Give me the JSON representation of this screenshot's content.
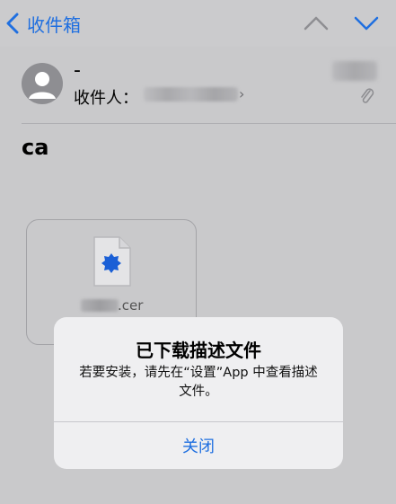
{
  "nav": {
    "back_label": "收件箱"
  },
  "email": {
    "sender": "-",
    "recipient_label": "收件人：",
    "subject": "ca",
    "attachment_ext": ".cer"
  },
  "alert": {
    "title": "已下载描述文件",
    "message": "若要安装，请先在“设置”App 中查看描述文件。",
    "close_label": "关闭"
  },
  "colors": {
    "accent": "#1f6fe0",
    "attachment_badge": "#1a5fd6"
  }
}
